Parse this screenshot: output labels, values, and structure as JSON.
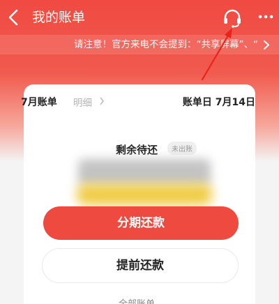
{
  "header": {
    "title": "我的账单",
    "back_icon": "chevron-left-icon",
    "support_icon": "headset-icon",
    "more_icon": "more-dots-icon"
  },
  "notice": {
    "text": "请注意！官方来电不会提到：“共享屏幕”、“"
  },
  "card": {
    "month_label": "7月账单",
    "detail_link": "明细",
    "billing_day": "账单日 7月14日",
    "remaining_label": "剩余待还",
    "status_badge": "未出账",
    "primary_button": "分期还款",
    "secondary_button": "提前还款",
    "all_bills_link": "全部账单"
  },
  "colors": {
    "brand_red": "#ef4a3f",
    "annotation_red": "#e8241a"
  }
}
